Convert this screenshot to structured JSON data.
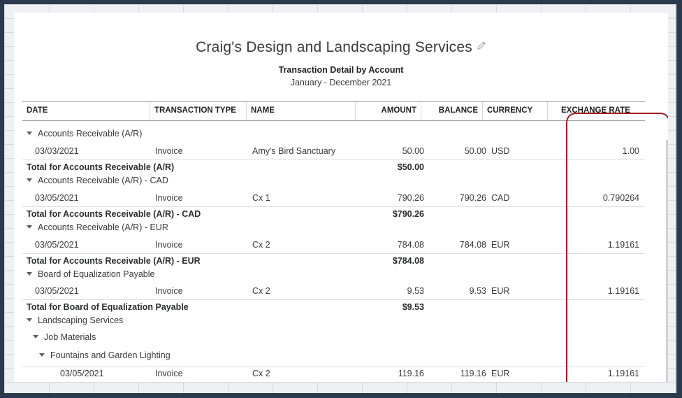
{
  "report": {
    "company": "Craig's Design and Landscaping Services",
    "title": "Transaction Detail by Account",
    "period": "January - December 2021"
  },
  "columns": [
    "DATE",
    "TRANSACTION TYPE",
    "NAME",
    "AMOUNT",
    "BALANCE",
    "CURRENCY",
    "EXCHANGE RATE"
  ],
  "rows": [
    {
      "kind": "group",
      "label": "Accounts Receivable (A/R)"
    },
    {
      "kind": "txn",
      "date": "03/03/2021",
      "type": "Invoice",
      "name": "Amy's Bird Sanctuary",
      "amount": "50.00",
      "balance": "50.00",
      "currency": "USD",
      "rate": "1.00"
    },
    {
      "kind": "total",
      "label": "Total for Accounts Receivable (A/R)",
      "amount": "$50.00"
    },
    {
      "kind": "group",
      "label": "Accounts Receivable (A/R) - CAD"
    },
    {
      "kind": "txn",
      "date": "03/05/2021",
      "type": "Invoice",
      "name": "Cx 1",
      "amount": "790.26",
      "balance": "790.26",
      "currency": "CAD",
      "rate": "0.790264"
    },
    {
      "kind": "total",
      "label": "Total for Accounts Receivable (A/R) - CAD",
      "amount": "$790.26"
    },
    {
      "kind": "group",
      "label": "Accounts Receivable (A/R) - EUR"
    },
    {
      "kind": "txn",
      "date": "03/05/2021",
      "type": "Invoice",
      "name": "Cx 2",
      "amount": "784.08",
      "balance": "784.08",
      "currency": "EUR",
      "rate": "1.19161"
    },
    {
      "kind": "total",
      "label": "Total for Accounts Receivable (A/R) - EUR",
      "amount": "$784.08"
    },
    {
      "kind": "group",
      "label": "Board of Equalization Payable"
    },
    {
      "kind": "txn",
      "date": "03/05/2021",
      "type": "Invoice",
      "name": "Cx 2",
      "amount": "9.53",
      "balance": "9.53",
      "currency": "EUR",
      "rate": "1.19161"
    },
    {
      "kind": "total",
      "label": "Total for Board of Equalization Payable",
      "amount": "$9.53"
    },
    {
      "kind": "group",
      "label": "Landscaping Services"
    },
    {
      "kind": "group",
      "label": "Job Materials"
    },
    {
      "kind": "group",
      "label": "Fountains and Garden Lighting"
    },
    {
      "kind": "txn",
      "date": "03/05/2021",
      "type": "Invoice",
      "name": "Cx 2",
      "amount": "119.16",
      "balance": "119.16",
      "currency": "EUR",
      "rate": "1.19161"
    }
  ]
}
